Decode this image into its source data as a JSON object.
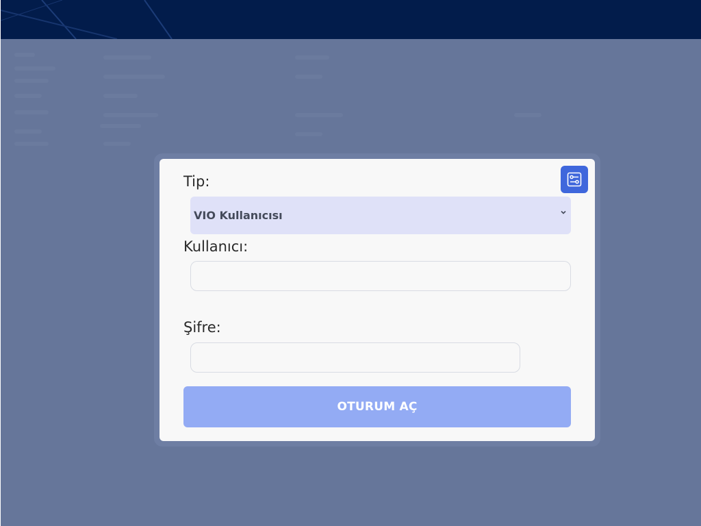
{
  "form": {
    "type_label": "Tip:",
    "type_select": {
      "selected": "VIO Kullanıcısı"
    },
    "user_label": "Kullanıcı:",
    "user_input": {
      "value": "",
      "placeholder": ""
    },
    "password_label": "Şifre:",
    "password_input": {
      "value": "",
      "placeholder": ""
    },
    "login_button_label": "OTURUM AÇ",
    "settings_icon": "sliders-settings-icon"
  },
  "colors": {
    "banner": "#021c4b",
    "overlay": "#66769a",
    "dialog_bg": "#f8f8f8",
    "select_bg": "#dfe1f8",
    "login_button": "#93abf4",
    "settings_button": "#3f67dc"
  }
}
